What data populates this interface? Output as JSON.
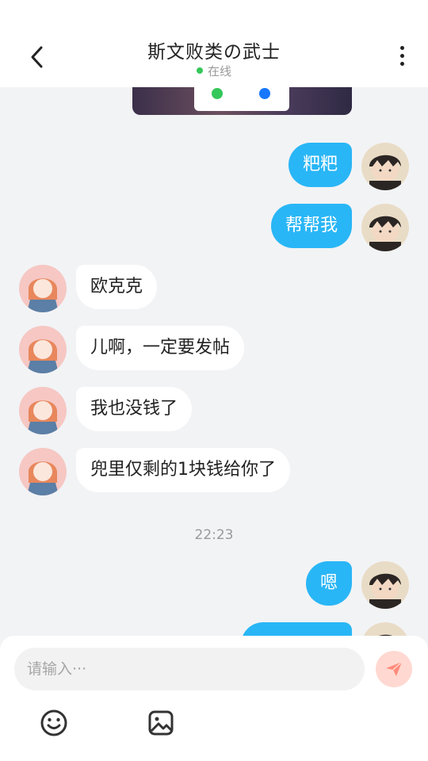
{
  "header": {
    "title": "斯文败类の武士",
    "status": "在线"
  },
  "messages": [
    {
      "side": "me",
      "text": "粑粑"
    },
    {
      "side": "me",
      "text": "帮帮我"
    },
    {
      "side": "them",
      "text": "欧克克"
    },
    {
      "side": "them",
      "text": "儿啊，一定要发帖"
    },
    {
      "side": "them",
      "text": "我也没钱了"
    },
    {
      "side": "them",
      "text": "兜里仅剩的1块钱给你了"
    },
    {
      "side": "me",
      "text": "嗯"
    }
  ],
  "timestamp": "22:23",
  "composer": {
    "placeholder": "请输入···",
    "send_icon": "paper-plane-icon",
    "tools": [
      "emoji-icon",
      "image-icon"
    ]
  },
  "colors": {
    "accent": "#29b6f6",
    "online": "#34c759",
    "send_button": "#ffd9d1",
    "send_icon": "#ff8a7a",
    "background": "#f2f3f5"
  }
}
